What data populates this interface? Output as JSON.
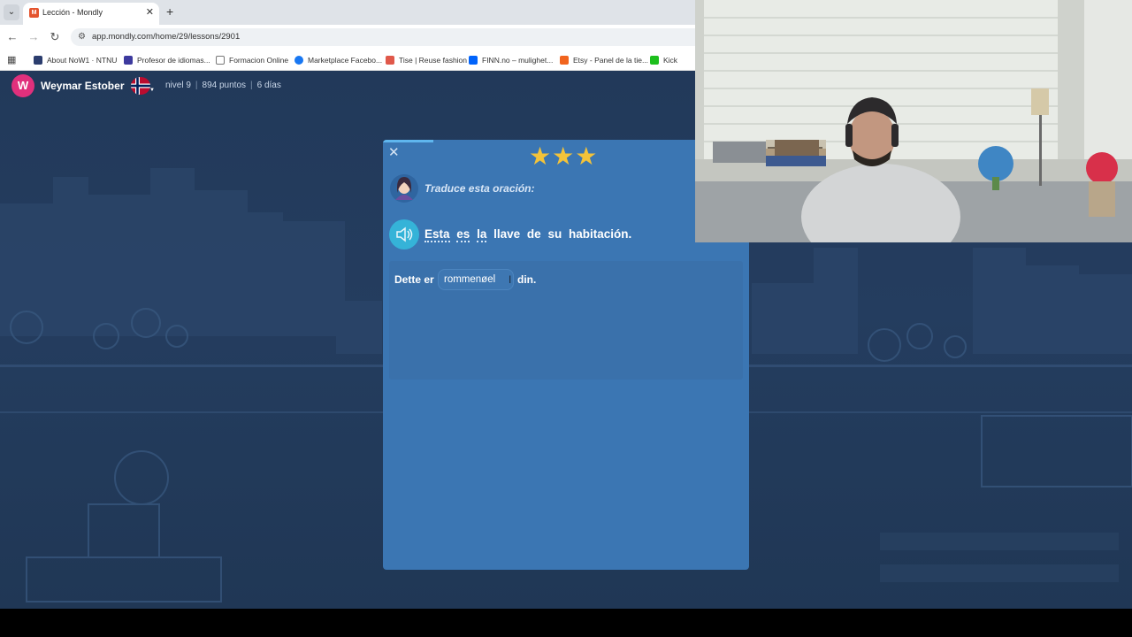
{
  "browser": {
    "tab_title": "Lección - Mondly",
    "tab_favicon_letter": "M",
    "url": "app.mondly.com/home/29/lessons/2901",
    "bookmarks": [
      {
        "label": "About NoW1 · NTNU",
        "color": "#2b3d6e"
      },
      {
        "label": "Profesor de idiomas...",
        "color": "#3d3a9e"
      },
      {
        "label": "Formacion Online",
        "color": "#888888"
      },
      {
        "label": "Marketplace Facebo...",
        "color": "#1877f2"
      },
      {
        "label": "Tise | Reuse fashion",
        "color": "#e0584a"
      },
      {
        "label": "FINN.no – mulighet...",
        "color": "#0063fb"
      },
      {
        "label": "Etsy - Panel de la tie...",
        "color": "#f1641e"
      },
      {
        "label": "Kick",
        "color": "#1dbf1d"
      }
    ]
  },
  "user": {
    "avatar_letter": "W",
    "name": "Weymar Estober",
    "level": "nivel 9",
    "points": "894 puntos",
    "streak": "6 días"
  },
  "lesson": {
    "stars": "★★★",
    "instruction": "Traduce esta oración:",
    "sentence_words": [
      "Esta",
      "es",
      "la",
      "llave",
      "de",
      "su",
      "habitación."
    ],
    "answer_prefix": "Dette er",
    "answer_value": "rommenøel",
    "answer_suffix": "din."
  },
  "colors": {
    "accent": "#3b76b3",
    "star": "#f3c33a",
    "avatar": "#e0307c",
    "speaker": "#35b3d8"
  }
}
